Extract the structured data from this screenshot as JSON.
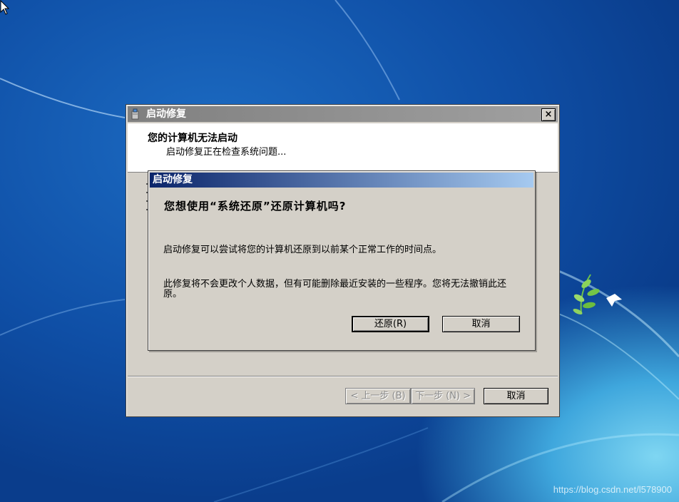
{
  "colors": {
    "desktop_base": "#0d4aa0",
    "dialog_face": "#d4d0c8",
    "active_title_start": "#0a246a",
    "active_title_end": "#a6caf0",
    "inactive_title": "#808080"
  },
  "icons": {
    "cursor": "arrow-cursor-icon",
    "app": "startup-repair-icon",
    "close": "close-icon"
  },
  "main_window": {
    "title": "启动修复",
    "close_label": "×",
    "header_title": "您的计算机无法启动",
    "header_subtitle": "启动修复正在检查系统问题...",
    "buttons": {
      "back": "< 上一步 (B)",
      "next": "下一步 (N) >",
      "cancel": "取消"
    }
  },
  "restore_dialog": {
    "title": "启动修复",
    "question": "您想使用“系统还原”还原计算机吗?",
    "paragraph1": "启动修复可以尝试将您的计算机还原到以前某个正常工作的时间点。",
    "paragraph2": "此修复将不会更改个人数据，但有可能删除最近安装的一些程序。您将无法撤销此还原。",
    "buttons": {
      "restore": "还原(R)",
      "cancel": "取消"
    }
  },
  "watermark": "https://blog.csdn.net/l578900"
}
